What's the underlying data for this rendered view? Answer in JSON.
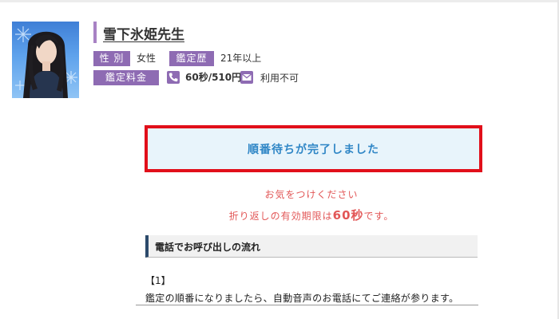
{
  "profile": {
    "name": "雪下氷姫先生",
    "gender_label": "性 別",
    "gender_value": "女性",
    "career_label": "鑑定歴",
    "career_value": "21年以上",
    "fee_label": "鑑定料金",
    "fee_value": "60秒/510円",
    "mail_value": "利用不可",
    "icons": [
      "phone-icon",
      "mail-icon"
    ]
  },
  "status": {
    "message": "順番待ちが完了しました",
    "border_color": "#e10f1a",
    "text_color": "#2f86c6"
  },
  "notice": {
    "line1": "お気をつけください",
    "line2_before": "折り返しの有効期限は",
    "line2_emphasis": "60秒",
    "line2_after": "です。"
  },
  "flow": {
    "title": "電話でお呼び出しの流れ",
    "step_number": "【1】",
    "step_text": "鑑定の順番になりましたら、自動音声のお電話にてご連絡が参ります。"
  },
  "colors": {
    "accent_purple": "#8e6bb3",
    "notice_red": "#e25757",
    "section_border": "#2c4a6b"
  }
}
